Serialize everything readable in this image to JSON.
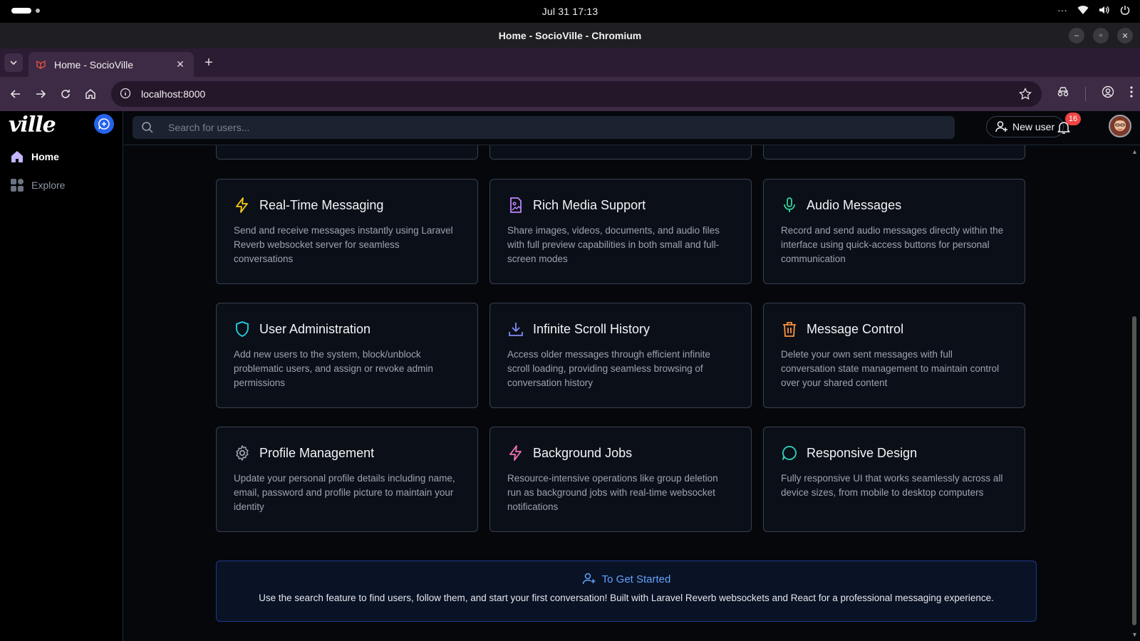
{
  "os": {
    "datetime": "Jul 31  17:13",
    "overflow": "···"
  },
  "window": {
    "title": "Home - SocioVille - Chromium"
  },
  "tab": {
    "title": "Home - SocioVille",
    "close": "✕",
    "new_tab": "+"
  },
  "toolbar": {
    "url": "localhost:8000"
  },
  "app": {
    "brand": "ville",
    "nav": {
      "home": "Home",
      "explore": "Explore"
    },
    "search_placeholder": "Search for users...",
    "new_user": "New user",
    "notification_count": "16"
  },
  "features": [
    {
      "title": "Real-Time Messaging",
      "desc": "Send and receive messages instantly using Laravel Reverb websocket server for seamless conversations",
      "icon": "lightning-icon",
      "color": "#facc15"
    },
    {
      "title": "Rich Media Support",
      "desc": "Share images, videos, documents, and audio files with full preview capabilities in both small and full-screen modes",
      "icon": "media-file-icon",
      "color": "#c084fc"
    },
    {
      "title": "Audio Messages",
      "desc": "Record and send audio messages directly within the interface using quick-access buttons for personal communication",
      "icon": "microphone-icon",
      "color": "#34d399"
    },
    {
      "title": "User Administration",
      "desc": "Add new users to the system, block/unblock problematic users, and assign or revoke admin permissions",
      "icon": "shield-icon",
      "color": "#22d3ee"
    },
    {
      "title": "Infinite Scroll History",
      "desc": "Access older messages through efficient infinite scroll loading, providing seamless browsing of conversation history",
      "icon": "download-icon",
      "color": "#818cf8"
    },
    {
      "title": "Message Control",
      "desc": "Delete your own sent messages with full conversation state management to maintain control over your shared content",
      "icon": "trash-icon",
      "color": "#fb923c"
    },
    {
      "title": "Profile Management",
      "desc": "Update your personal profile details including name, email, password and profile picture to maintain your identity",
      "icon": "gear-icon",
      "color": "#9ca3af"
    },
    {
      "title": "Background Jobs",
      "desc": "Resource-intensive operations like group deletion run as background jobs with real-time websocket notifications",
      "icon": "lightning-icon",
      "color": "#f472b6"
    },
    {
      "title": "Responsive Design",
      "desc": "Fully responsive UI that works seamlessly across all device sizes, from mobile to desktop computers",
      "icon": "chat-bubble-icon",
      "color": "#2dd4bf"
    }
  ],
  "get_started": {
    "title": "To Get Started",
    "text": "Use the search feature to find users, follow them, and start your first conversation! Built with Laravel Reverb websockets and React for a professional messaging experience."
  },
  "colors": {
    "accent": "#2563eb",
    "badge": "#ef4444",
    "link": "#60a5fa"
  }
}
